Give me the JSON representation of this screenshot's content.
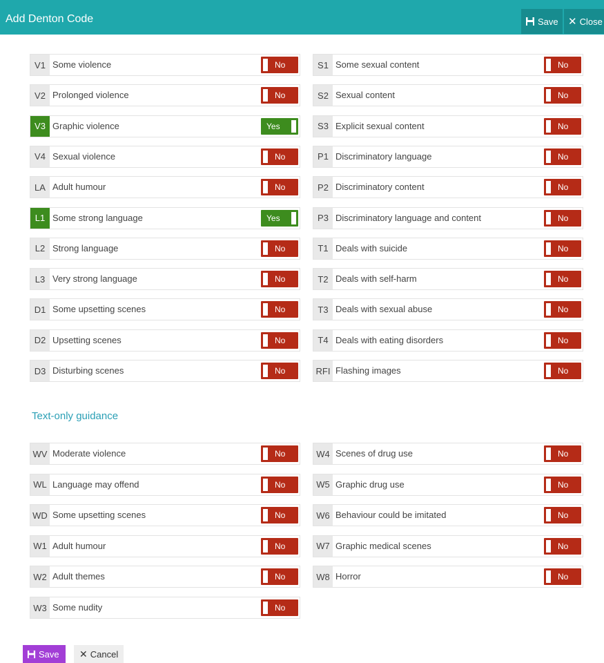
{
  "dialog": {
    "title": "Add Denton Code",
    "save_label": "Save",
    "close_label": "Close"
  },
  "ratings": [
    {
      "code": "V1",
      "label": "Some violence",
      "value": "No"
    },
    {
      "code": "V2",
      "label": "Prolonged violence",
      "value": "No"
    },
    {
      "code": "V3",
      "label": "Graphic violence",
      "value": "Yes"
    },
    {
      "code": "V4",
      "label": "Sexual violence",
      "value": "No"
    },
    {
      "code": "LA",
      "label": "Adult humour",
      "value": "No"
    },
    {
      "code": "L1",
      "label": "Some strong language",
      "value": "Yes"
    },
    {
      "code": "L2",
      "label": "Strong language",
      "value": "No"
    },
    {
      "code": "L3",
      "label": "Very strong language",
      "value": "No"
    },
    {
      "code": "D1",
      "label": "Some upsetting scenes",
      "value": "No"
    },
    {
      "code": "D2",
      "label": "Upsetting scenes",
      "value": "No"
    },
    {
      "code": "D3",
      "label": "Disturbing scenes",
      "value": "No"
    },
    {
      "code": "S1",
      "label": "Some sexual content",
      "value": "No"
    },
    {
      "code": "S2",
      "label": "Sexual content",
      "value": "No"
    },
    {
      "code": "S3",
      "label": "Explicit sexual content",
      "value": "No"
    },
    {
      "code": "P1",
      "label": "Discriminatory language",
      "value": "No"
    },
    {
      "code": "P2",
      "label": "Discriminatory content",
      "value": "No"
    },
    {
      "code": "P3",
      "label": "Discriminatory language and content",
      "value": "No"
    },
    {
      "code": "T1",
      "label": "Deals with suicide",
      "value": "No"
    },
    {
      "code": "T2",
      "label": "Deals with self-harm",
      "value": "No"
    },
    {
      "code": "T3",
      "label": "Deals with sexual abuse",
      "value": "No"
    },
    {
      "code": "T4",
      "label": "Deals with eating disorders",
      "value": "No"
    },
    {
      "code": "RFI",
      "label": "Flashing images",
      "value": "No"
    }
  ],
  "text_guidance": {
    "heading": "Text-only guidance",
    "items": [
      {
        "code": "WV",
        "label": "Moderate violence",
        "value": "No"
      },
      {
        "code": "WL",
        "label": "Language may offend",
        "value": "No"
      },
      {
        "code": "WD",
        "label": "Some upsetting scenes",
        "value": "No"
      },
      {
        "code": "W1",
        "label": "Adult humour",
        "value": "No"
      },
      {
        "code": "W2",
        "label": "Adult themes",
        "value": "No"
      },
      {
        "code": "W3",
        "label": "Some nudity",
        "value": "No"
      },
      {
        "code": "W4",
        "label": "Scenes of drug use",
        "value": "No"
      },
      {
        "code": "W5",
        "label": "Graphic drug use",
        "value": "No"
      },
      {
        "code": "W6",
        "label": "Behaviour could be imitated",
        "value": "No"
      },
      {
        "code": "W7",
        "label": "Graphic medical scenes",
        "value": "No"
      },
      {
        "code": "W8",
        "label": "Horror",
        "value": "No"
      }
    ]
  },
  "footer": {
    "save_label": "Save",
    "cancel_label": "Cancel"
  },
  "colors": {
    "header": "#1fa8ac",
    "toggle_no": "#b52b17",
    "toggle_yes": "#3d8c1e",
    "section_heading": "#2a9fb5",
    "save_button": "#a23ed6"
  },
  "icons": {
    "save": "floppy-disk-icon",
    "close": "close-icon",
    "cancel": "close-icon"
  }
}
